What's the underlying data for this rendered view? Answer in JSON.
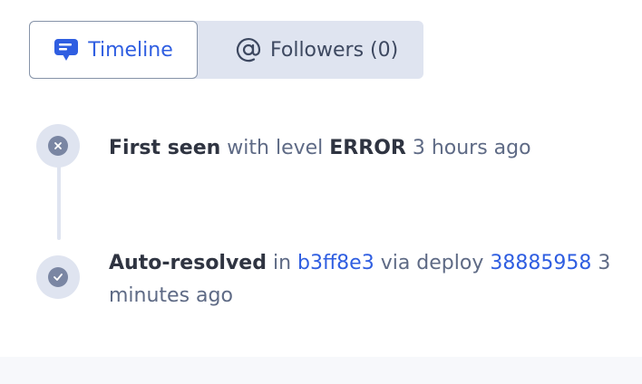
{
  "tabs": {
    "timeline_label": "Timeline",
    "followers_label": "Followers (0)"
  },
  "events": [
    {
      "title": "First seen",
      "connector": "with level",
      "level": "ERROR",
      "time": "3 hours ago"
    },
    {
      "title": "Auto-resolved",
      "connector1": "in",
      "commit": "b3ff8e3",
      "connector2": "via deploy",
      "deploy": "38885958",
      "time": "3 minutes ago"
    }
  ],
  "colors": {
    "accent": "#2f5ee1",
    "marker_bg": "#dfe4f0",
    "marker_dot": "#7a86a3",
    "text_strong": "#2f3441",
    "text_muted": "#5e6a85"
  }
}
